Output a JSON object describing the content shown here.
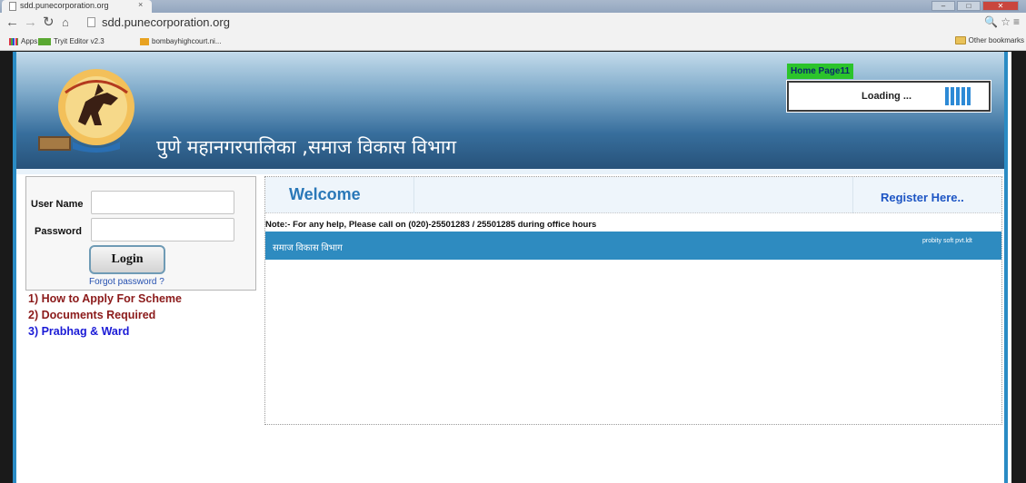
{
  "browser": {
    "tab_title": "sdd.punecorporation.org",
    "tab_close": "×",
    "url": "sdd.punecorporation.org",
    "bookmarks": [
      "Apps",
      "Tryit Editor v2.3",
      "bombayhighcourt.ni..."
    ],
    "other_bookmarks": "Other bookmarks"
  },
  "header": {
    "title": "पुणे महानगरपालिका ,समाज विकास विभाग",
    "home_link": "Home Page11",
    "loading_text": "Loading ..."
  },
  "login": {
    "username_label": "User Name",
    "password_label": "Password",
    "button_label": "Login",
    "forgot_link": "Forgot password ?"
  },
  "links": [
    {
      "label": "1) How to Apply For Scheme",
      "color": "#8b1a1a"
    },
    {
      "label": "2) Documents Required",
      "color": "#8b1a1a"
    },
    {
      "label": "3) Prabhag & Ward",
      "color": "#1a1ad6"
    }
  ],
  "content": {
    "welcome": "Welcome",
    "register": "Register Here..",
    "note": "Note:- For any help, Please call on (020)-25501283 / 25501285 during office hours",
    "strip_left": "समाज विकास विभाग",
    "strip_right": "probity soft pvt.ldt"
  },
  "colors": {
    "accent": "#2e8bc0",
    "header_dark": "#27527a",
    "home_badge": "#2bc42b"
  }
}
